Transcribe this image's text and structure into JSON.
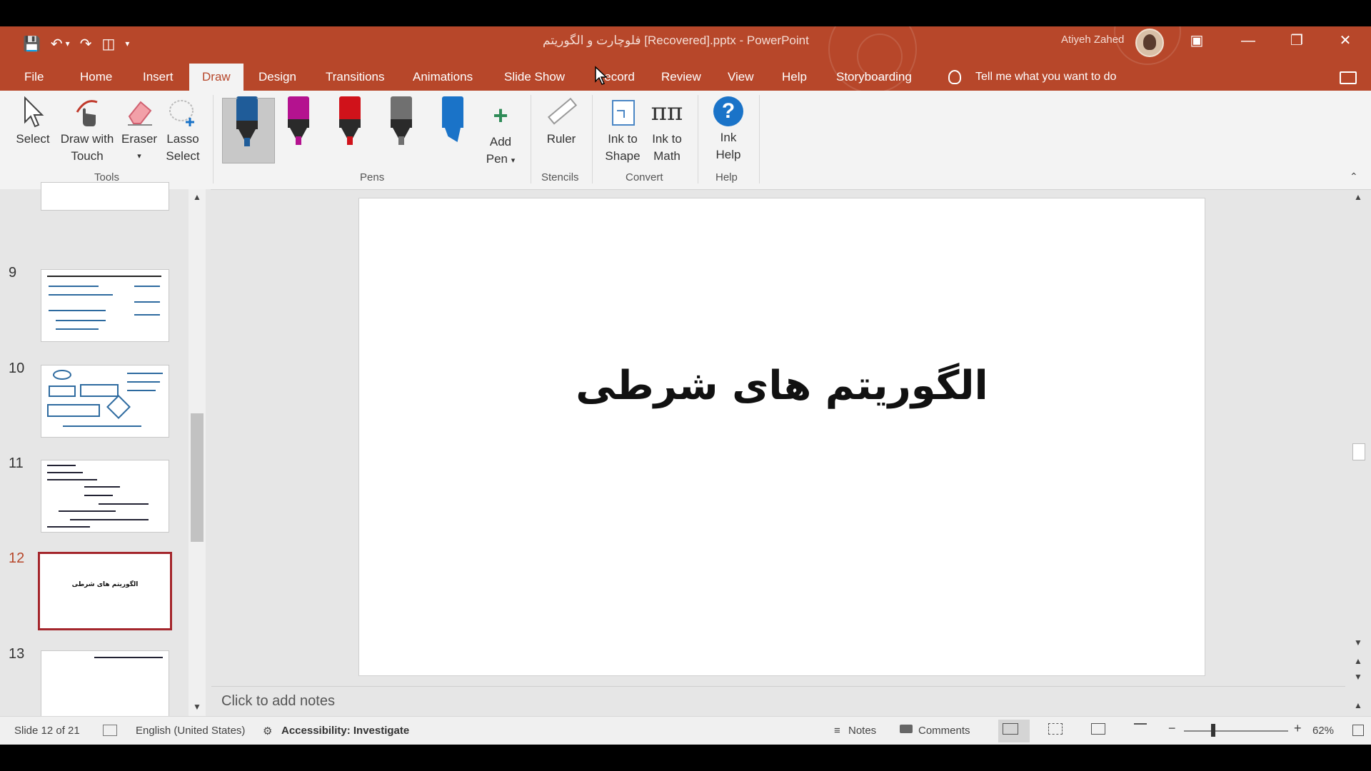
{
  "window": {
    "title": "فلوچارت و الگوریتم [Recovered].pptx - PowerPoint",
    "user": "Atiyeh Zahed"
  },
  "tabs": [
    "File",
    "Home",
    "Insert",
    "Draw",
    "Design",
    "Transitions",
    "Animations",
    "Slide Show",
    "Record",
    "Review",
    "View",
    "Help",
    "Storyboarding"
  ],
  "active_tab": "Draw",
  "tell_me": "Tell me what you want to do",
  "ribbon": {
    "tools": {
      "select": "Select",
      "draw_touch_1": "Draw with",
      "draw_touch_2": "Touch",
      "eraser": "Eraser",
      "lasso_1": "Lasso",
      "lasso_2": "Select",
      "group": "Tools"
    },
    "pens": {
      "group": "Pens",
      "add_pen_1": "Add",
      "add_pen_2": "Pen",
      "colors": [
        "#1f5c99",
        "#b4128f",
        "#d0121a",
        "#707070",
        "#1a73c8"
      ]
    },
    "stencils": {
      "ruler": "Ruler",
      "group": "Stencils"
    },
    "convert": {
      "ink_shape_1": "Ink to",
      "ink_shape_2": "Shape",
      "ink_math_1": "Ink to",
      "ink_math_2": "Math",
      "group": "Convert"
    },
    "help": {
      "ink_help_1": "Ink",
      "ink_help_2": "Help",
      "group": "Help"
    }
  },
  "thumbnails": {
    "slide_numbers": [
      "9",
      "10",
      "11",
      "12",
      "13"
    ],
    "selected": "12",
    "slide12_text": "الگوریتم های شرطی"
  },
  "slide": {
    "title": "الگوریتم های شرطی"
  },
  "notes_placeholder": "Click to add notes",
  "status": {
    "slide_counter": "Slide 12 of 21",
    "language": "English (United States)",
    "accessibility": "Accessibility: Investigate",
    "notes": "Notes",
    "comments": "Comments",
    "zoom": "62%"
  },
  "colors": {
    "accent": "#b7472a",
    "selected_border": "#a4262c"
  }
}
